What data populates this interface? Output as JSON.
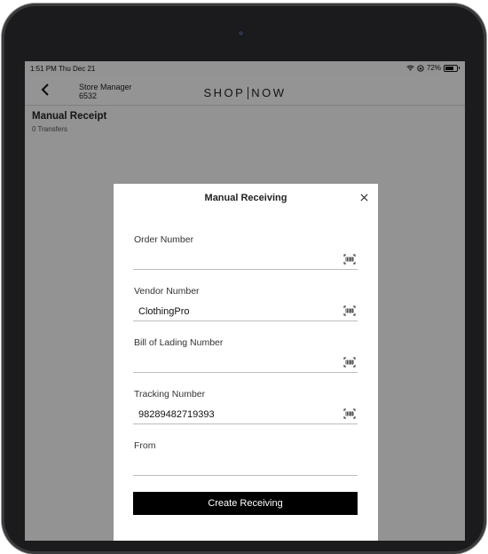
{
  "status_bar": {
    "time": "1:51 PM",
    "date": "Thu Dec 21",
    "battery": "72%"
  },
  "header": {
    "store_role": "Store Manager",
    "store_number": "6532",
    "brand_left": "SHOP",
    "brand_right": "NOW"
  },
  "page": {
    "title": "Manual Receipt",
    "subtitle": "0 Transfers"
  },
  "modal": {
    "title": "Manual Receiving",
    "fields": [
      {
        "label": "Order Number",
        "value": "",
        "scannable": true
      },
      {
        "label": "Vendor Number",
        "value": "ClothingPro",
        "scannable": true
      },
      {
        "label": "Bill of Lading Number",
        "value": "",
        "scannable": true
      },
      {
        "label": "Tracking Number",
        "value": "98289482719393",
        "scannable": true
      },
      {
        "label": "From",
        "value": "",
        "scannable": false
      }
    ],
    "submit_label": "Create Receiving"
  },
  "colors": {
    "overlay": "#000000",
    "button_bg": "#000000",
    "button_text": "#ffffff"
  },
  "icons": [
    "back-chevron-icon",
    "wifi-icon",
    "orientation-lock-icon",
    "battery-icon",
    "close-icon",
    "barcode-scan-icon"
  ]
}
